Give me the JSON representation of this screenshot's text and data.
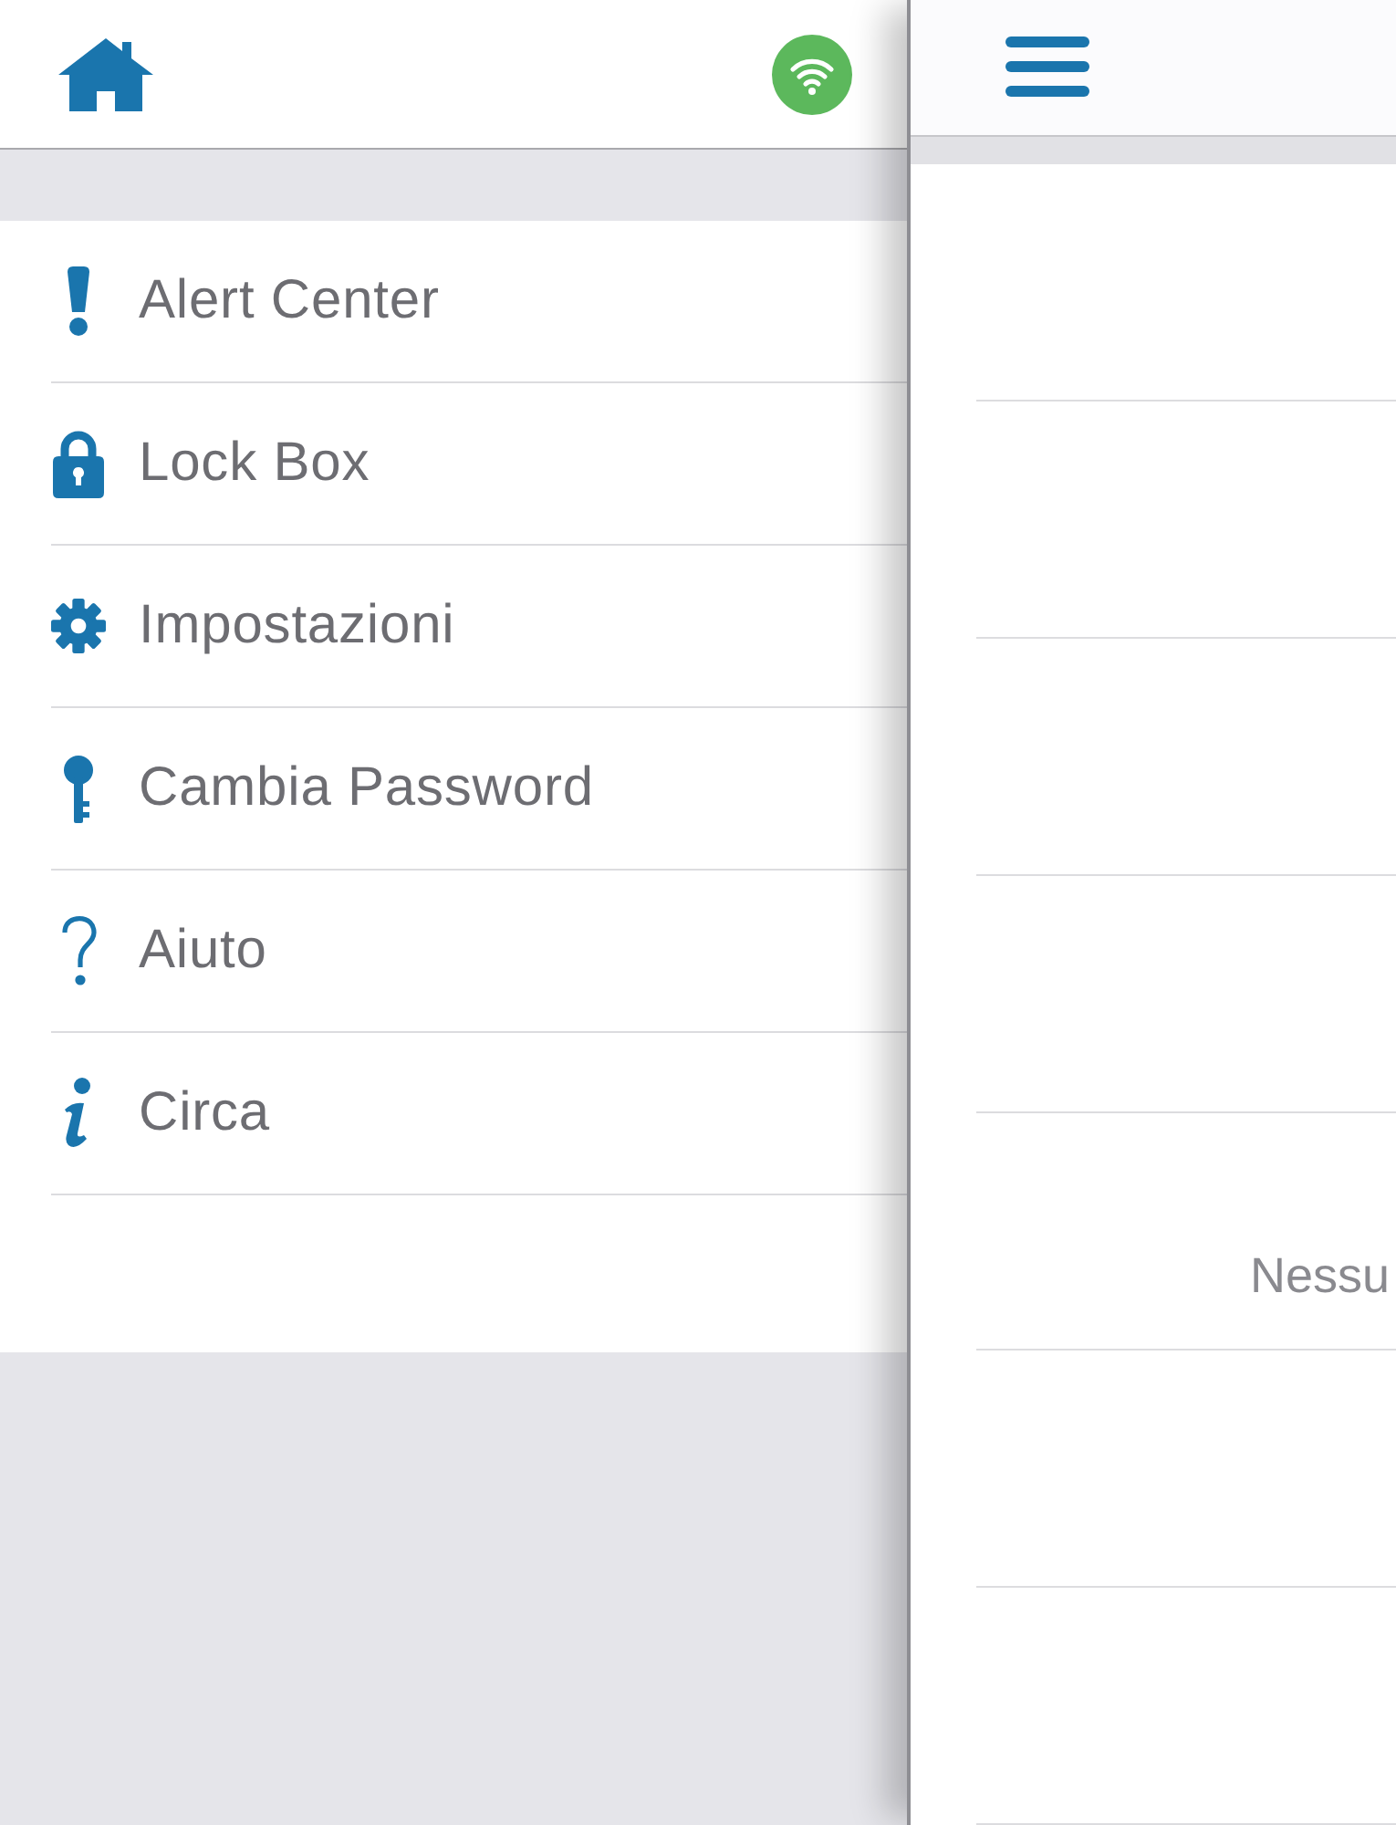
{
  "drawer": {
    "menu": [
      {
        "label": "Alert Center",
        "kind": "alert"
      },
      {
        "label": "Lock Box",
        "kind": "lock"
      },
      {
        "label": "Impostazioni",
        "kind": "settings"
      },
      {
        "label": "Cambia Password",
        "kind": "key"
      },
      {
        "label": "Aiuto",
        "kind": "help"
      },
      {
        "label": "Circa",
        "kind": "info"
      }
    ]
  },
  "main": {
    "message": "Nessu"
  }
}
